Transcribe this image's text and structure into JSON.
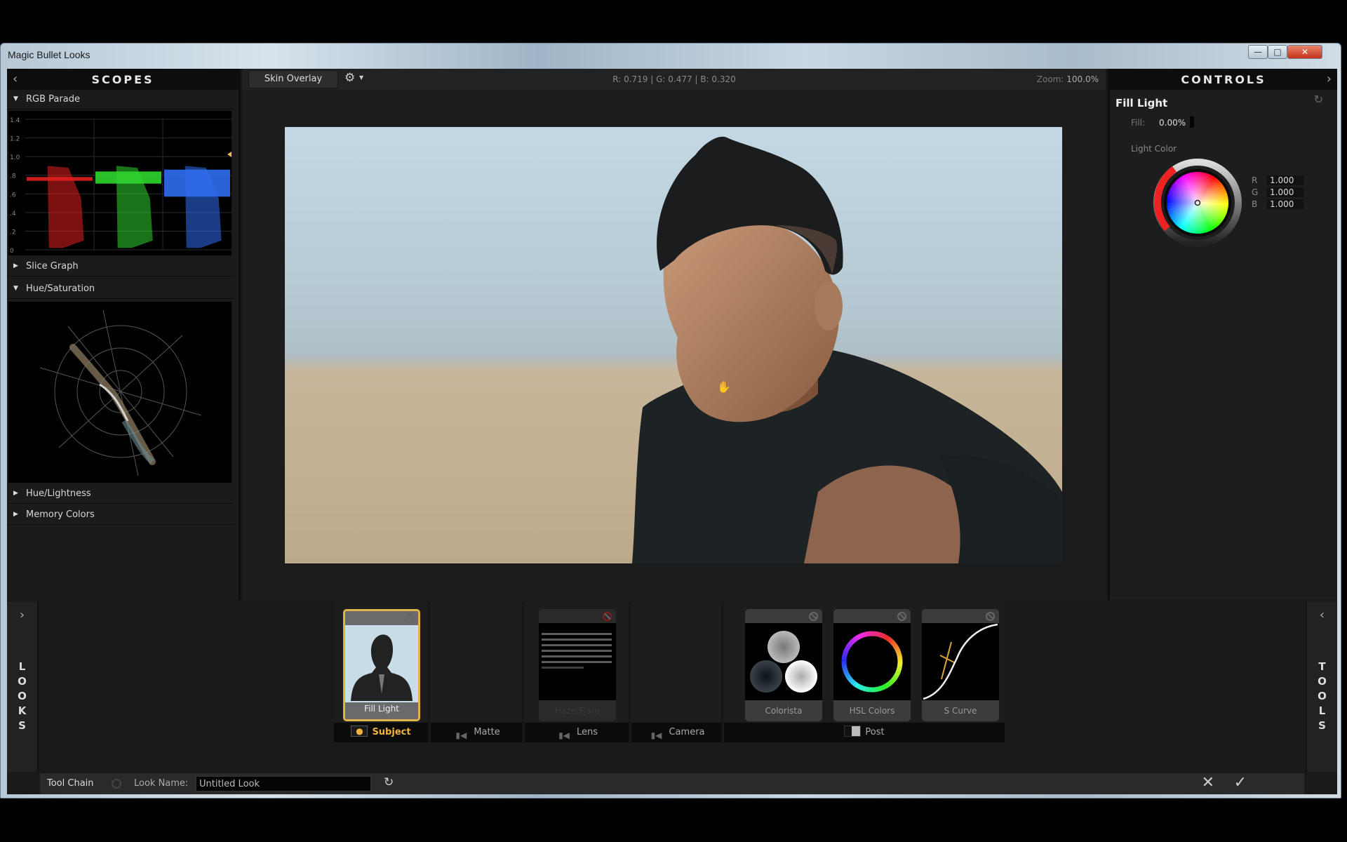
{
  "window": {
    "title": "Magic Bullet Looks"
  },
  "scopes": {
    "title": "SCOPES",
    "sections": [
      {
        "label": "RGB Parade",
        "expanded": true
      },
      {
        "label": "Slice Graph",
        "expanded": false
      },
      {
        "label": "Hue/Saturation",
        "expanded": true
      },
      {
        "label": "Hue/Lightness",
        "expanded": false
      },
      {
        "label": "Memory Colors",
        "expanded": false
      }
    ],
    "parade": {
      "y_ticks": [
        "1.4",
        "1.2",
        "1.0",
        ".8",
        ".6",
        ".4",
        ".2",
        "0"
      ],
      "channel_colors": [
        "#e0201f",
        "#2fd52f",
        "#2f6ef0"
      ]
    }
  },
  "viewer": {
    "skin_overlay_label": "Skin Overlay",
    "gear_icon": "gear-icon",
    "rgb_readout": "R: 0.719 | G: 0.477 | B: 0.320",
    "zoom_label": "Zoom:",
    "zoom_value": "100.0%"
  },
  "controls": {
    "title": "CONTROLS",
    "tool_name": "Fill Light",
    "fill_label": "Fill:",
    "fill_value": "0.00%",
    "light_color_label": "Light Color",
    "rgb": [
      {
        "key": "R",
        "value": "1.000"
      },
      {
        "key": "G",
        "value": "1.000"
      },
      {
        "key": "B",
        "value": "1.000"
      }
    ]
  },
  "bottom": {
    "looks_label": "LOOKS",
    "tools_label": "TOOLS",
    "categories": [
      {
        "label": "Subject",
        "active": true
      },
      {
        "label": "Matte",
        "active": false
      },
      {
        "label": "Lens",
        "active": false
      },
      {
        "label": "Camera",
        "active": false
      },
      {
        "label": "Post",
        "active": false
      }
    ],
    "tools": [
      {
        "name": "Fill Light",
        "category": "Subject",
        "selected": true
      },
      {
        "name": "Haze/Flare",
        "category": "Lens",
        "disabled": true
      },
      {
        "name": "Colorista",
        "category": "Post"
      },
      {
        "name": "HSL Colors",
        "category": "Post"
      },
      {
        "name": "S Curve",
        "category": "Post"
      }
    ],
    "accent_color": "#e0b24a"
  },
  "statusbar": {
    "tool_chain_label": "Tool Chain",
    "look_name_label": "Look Name:",
    "look_name_value": "Untitled Look",
    "cancel_icon": "close-icon",
    "ok_icon": "check-icon"
  }
}
